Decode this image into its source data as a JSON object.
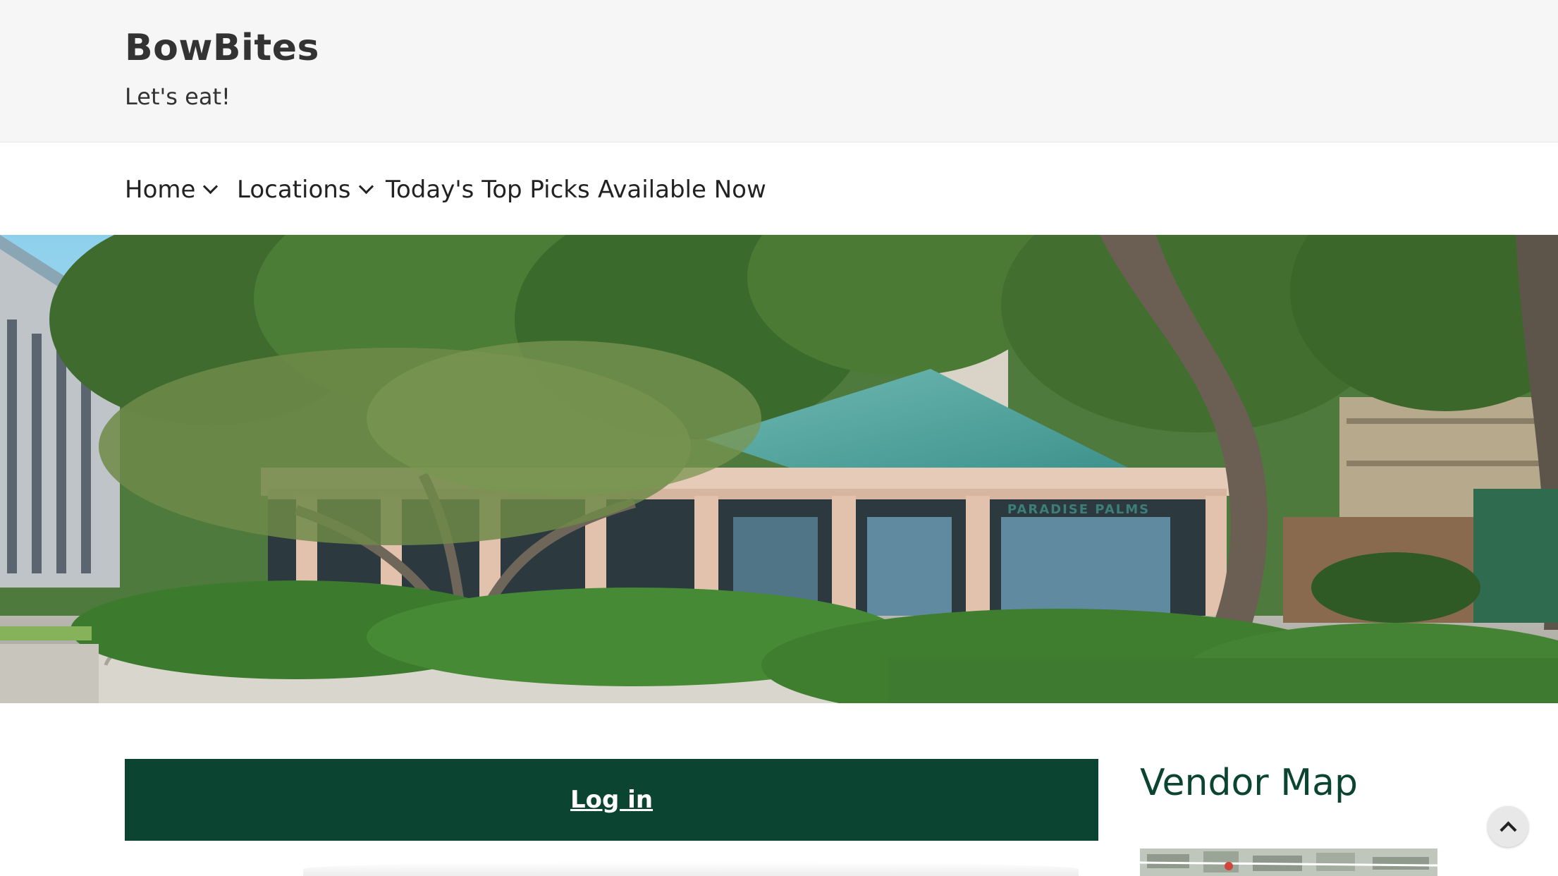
{
  "site": {
    "title": "BowBites",
    "tagline": "Let's eat!"
  },
  "nav": {
    "items": [
      {
        "label": "Home",
        "has_dropdown": true
      },
      {
        "label": "Locations",
        "has_dropdown": true
      },
      {
        "label": "Today's Top Picks",
        "has_dropdown": false
      },
      {
        "label": "Available Now",
        "has_dropdown": false
      }
    ]
  },
  "hero": {
    "sign_text": "PARADISE PALMS"
  },
  "main": {
    "login_label": "Log in"
  },
  "sidebar": {
    "vendor_map_title": "Vendor Map"
  },
  "icons": {
    "dropdown": "chevron-down-icon",
    "scroll_top": "chevron-up-icon"
  },
  "colors": {
    "header_bg": "#f6f6f6",
    "brand_green": "#0b4431",
    "text": "#333333"
  }
}
